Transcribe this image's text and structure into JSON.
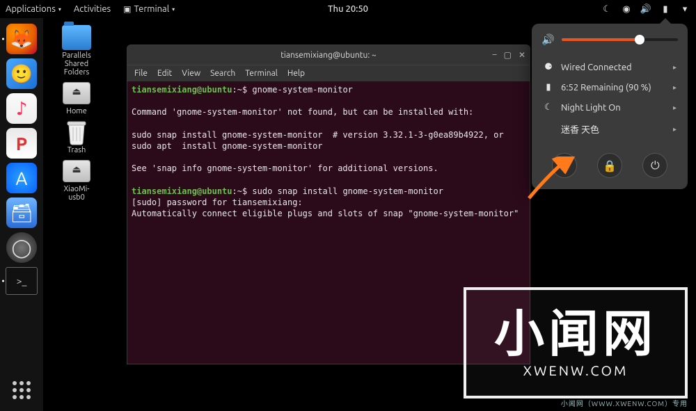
{
  "topbar": {
    "applications": "Applications",
    "activities": "Activities",
    "terminal": "Terminal",
    "clock": "Thu 20:50"
  },
  "desktop_icons": {
    "parallels": "Parallels\nShared\nFolders",
    "home": "Home",
    "trash": "Trash",
    "xiaomi": "XiaoMi-\nusb0"
  },
  "terminal_window": {
    "title": "tiansemixiang@ubuntu: ~",
    "menu": {
      "file": "File",
      "edit": "Edit",
      "view": "View",
      "search": "Search",
      "terminal": "Terminal",
      "help": "Help"
    },
    "prompt_user": "tiansemixiang@ubuntu",
    "prompt_path": ":~$",
    "cmd1": " gnome-system-monitor",
    "out_line1": "Command 'gnome-system-monitor' not found, but can be installed with:",
    "out_line2": "sudo snap install gnome-system-monitor  # version 3.32.1-3-g0ea89b4922, or",
    "out_line3": "sudo apt  install gnome-system-monitor",
    "out_line4": "See 'snap info gnome-system-monitor' for additional versions.",
    "cmd2": " sudo snap install gnome-system-monitor",
    "out_line5": "[sudo] password for tiansemixiang:",
    "out_line6": "Automatically connect eligible plugs and slots of snap \"gnome-system-monitor\"  -"
  },
  "syspopup": {
    "volume_percent": 67,
    "wired": "Wired Connected",
    "battery": "6:52 Remaining (90 %)",
    "nightlight": "Night Light On",
    "user": "迷香 天色"
  },
  "overlay": {
    "big": "小闻网",
    "sub": "XWENW.COM",
    "strip": "小闻网（WWW.XWENW.COM）专用"
  }
}
